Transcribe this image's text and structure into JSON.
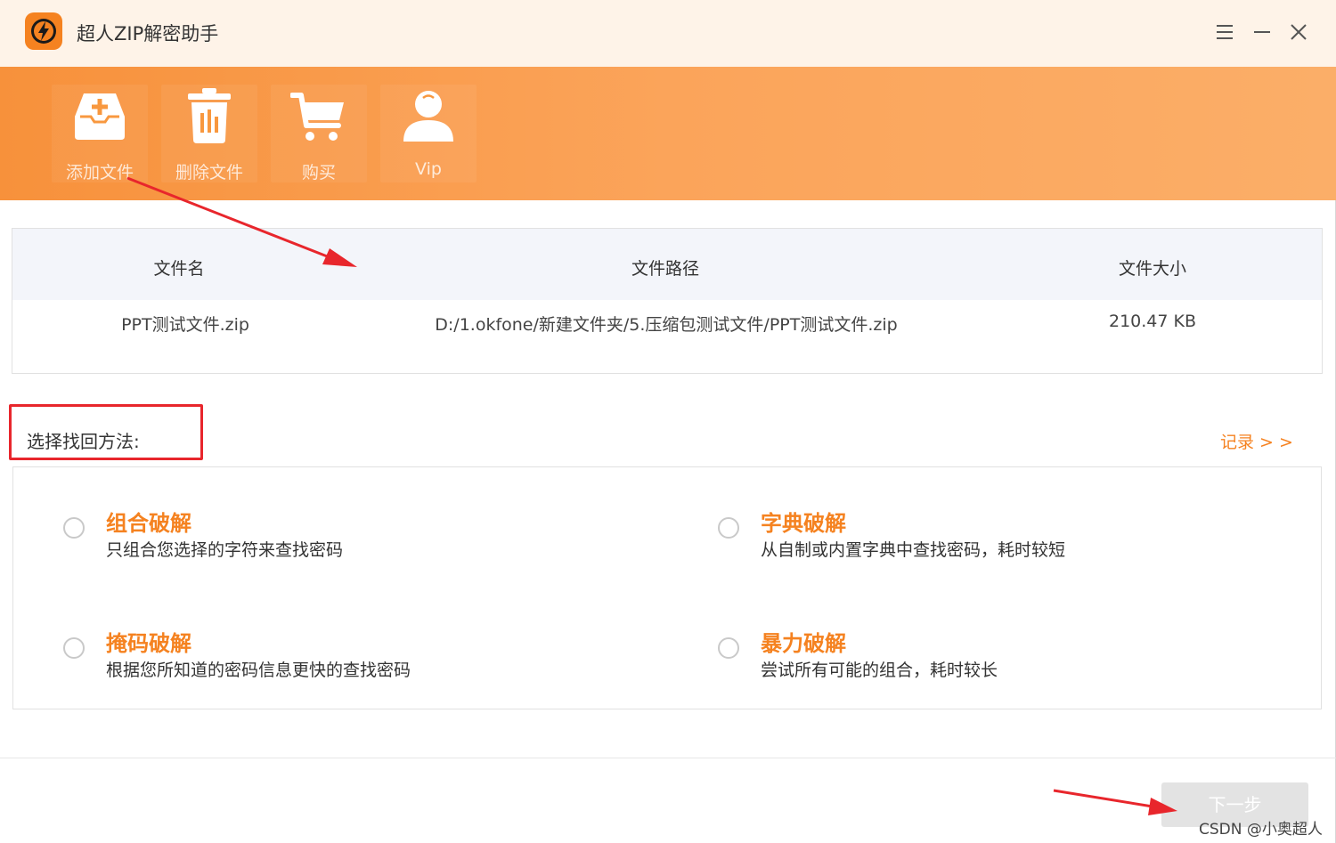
{
  "app": {
    "title": "超人ZIP解密助手",
    "accent_color": "#f58220",
    "window_controls": [
      "menu-icon",
      "minimize-icon",
      "close-icon"
    ]
  },
  "toolbar": {
    "items": [
      {
        "label": "添加文件",
        "icon": "add-file-icon"
      },
      {
        "label": "删除文件",
        "icon": "trash-icon"
      },
      {
        "label": "购买",
        "icon": "cart-icon"
      },
      {
        "label": "Vip",
        "icon": "user-icon"
      }
    ]
  },
  "file_table": {
    "columns": [
      "文件名",
      "文件路径",
      "文件大小"
    ],
    "rows": [
      {
        "name": "PPT测试文件.zip",
        "path": "D:/1.okfone/新建文件夹/5.压缩包测试文件/PPT测试文件.zip",
        "size": "210.47 KB"
      }
    ]
  },
  "methods": {
    "heading": "选择找回方法:",
    "record_link": "记录 > >",
    "options": [
      {
        "title": "组合破解",
        "desc": "只组合您选择的字符来查找密码",
        "selected": false
      },
      {
        "title": "字典破解",
        "desc": "从自制或内置字典中查找密码，耗时较短",
        "selected": false
      },
      {
        "title": "掩码破解",
        "desc": "根据您所知道的密码信息更快的查找密码",
        "selected": false
      },
      {
        "title": "暴力破解",
        "desc": "尝试所有可能的组合，耗时较长",
        "selected": false
      }
    ]
  },
  "footer": {
    "next_label": "下一步",
    "watermark": "CSDN @小奥超人"
  },
  "annotation_color": "#e8262c"
}
